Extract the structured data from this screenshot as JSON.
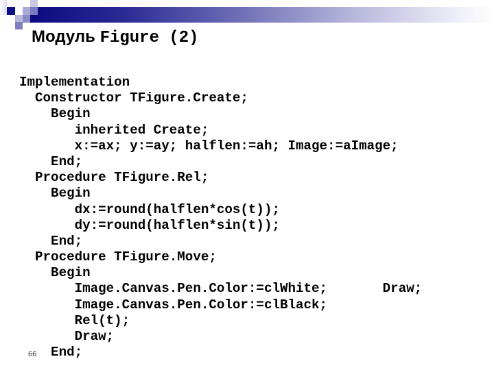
{
  "slide": {
    "title_prefix": "Модуль ",
    "title_code": "Figure (2)",
    "slide_number": "66",
    "accent_color": "#0b0b80"
  },
  "code_lines": [
    "Implementation",
    "  Constructor TFigure.Create;",
    "    Begin",
    "       inherited Create;",
    "       x:=ax; y:=ay; halflen:=ah; Image:=aImage;",
    "    End;",
    "  Procedure TFigure.Rel;",
    "    Begin",
    "       dx:=round(halflen*cos(t));",
    "       dy:=round(halflen*sin(t));",
    "    End;",
    "  Procedure TFigure.Move;",
    "    Begin",
    "       Image.Canvas.Pen.Color:=clWhite;       Draw;",
    "       Image.Canvas.Pen.Color:=clBlack;",
    "       Rel(t);",
    "       Draw;",
    "    End;"
  ]
}
